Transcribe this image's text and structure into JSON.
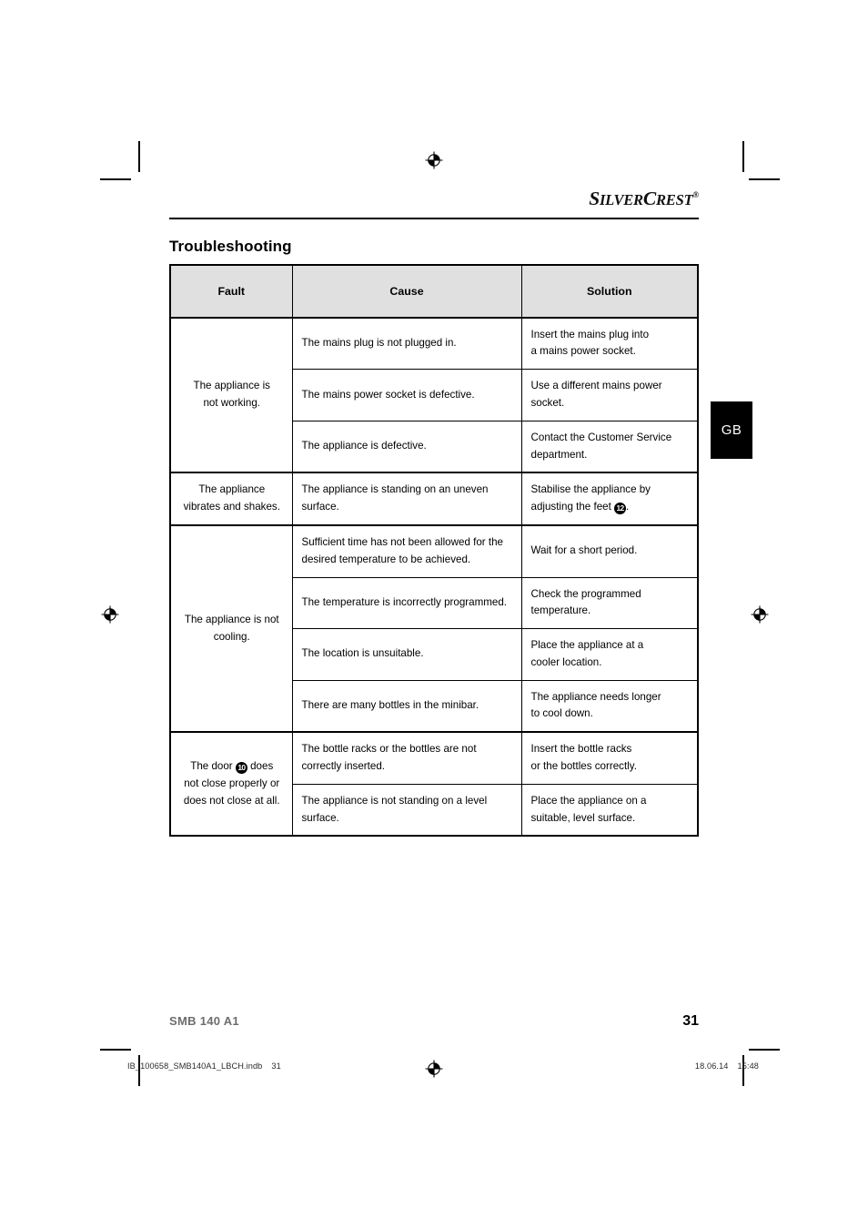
{
  "brand": {
    "name_part1": "S",
    "name_part2": "ILVER",
    "name_part3": "C",
    "name_part4": "REST",
    "registered_mark": "®"
  },
  "page": {
    "section_title": "Troubleshooting",
    "language_tab": "GB",
    "model": "SMB 140 A1",
    "page_number": "31"
  },
  "table": {
    "headers": {
      "fault": "Fault",
      "cause": "Cause",
      "solution": "Solution"
    },
    "groups": [
      {
        "fault": "The appliance is\nnot working.",
        "rows": [
          {
            "cause": "The mains plug is not plugged in.",
            "solution": "Insert the mains plug into\na mains power socket."
          },
          {
            "cause": "The mains power socket is defective.",
            "solution": "Use a different mains power\nsocket."
          },
          {
            "cause": "The appliance is defective.",
            "solution": "Contact the Customer Service\ndepartment."
          }
        ]
      },
      {
        "fault": "The appliance\nvibrates and shakes.",
        "rows": [
          {
            "cause": "The appliance is standing on an uneven\nsurface.",
            "solution_pre": "Stabilise the appliance by\nadjusting the feet ",
            "solution_ref": "12",
            "solution_post": "."
          }
        ]
      },
      {
        "fault": "The appliance is not\ncooling.",
        "rows": [
          {
            "cause": "Sufficient time has not been allowed for the\ndesired temperature to be achieved.",
            "solution": "Wait for a short period."
          },
          {
            "cause": "The temperature is incorrectly programmed.",
            "solution": "Check the programmed\ntemperature."
          },
          {
            "cause": "The location is unsuitable.",
            "solution": "Place the appliance at a\ncooler location."
          },
          {
            "cause": "There are many bottles in the minibar.",
            "solution": "The appliance needs longer\nto cool down."
          }
        ]
      },
      {
        "fault_pre": "The door ",
        "fault_ref": "10",
        "fault_post": " does\nnot close properly or\ndoes not close at all.",
        "rows": [
          {
            "cause": "The bottle racks or the bottles are not\ncorrectly inserted.",
            "solution": "Insert the bottle racks\nor the bottles correctly."
          },
          {
            "cause": "The appliance is not standing on a level\nsurface.",
            "solution": "Place the appliance on a\nsuitable, level surface."
          }
        ]
      }
    ]
  },
  "print_slug": {
    "filename": "IB_100658_SMB140A1_LBCH.indb",
    "sheet_number": "31",
    "date": "18.06.14",
    "time": "15:48"
  }
}
